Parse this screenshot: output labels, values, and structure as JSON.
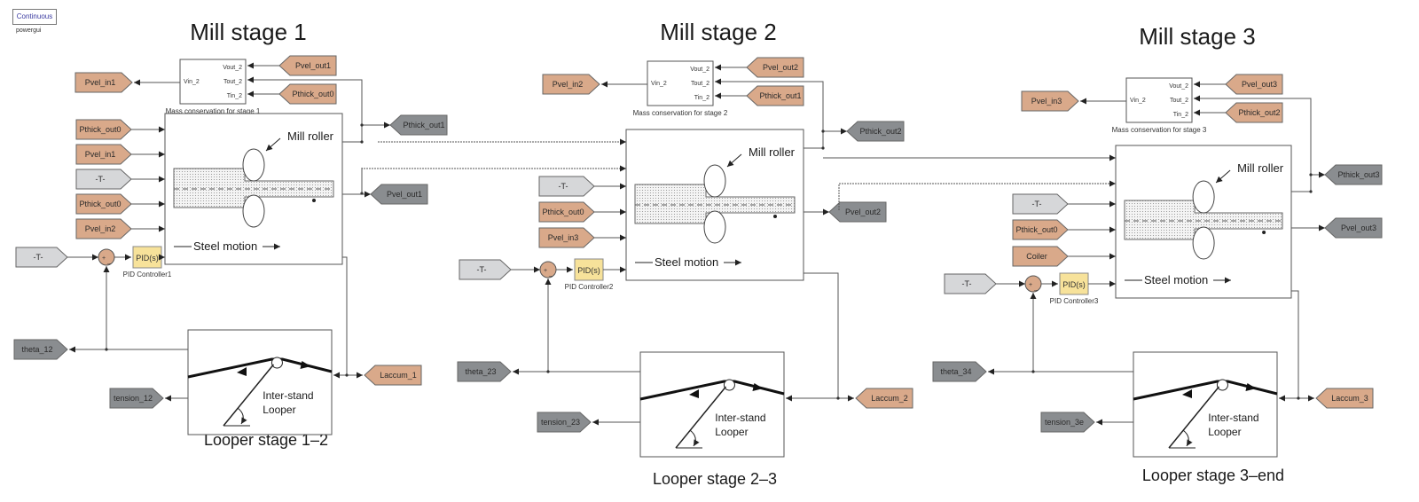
{
  "powergui": {
    "block_label": "Continuous",
    "name": "powergui"
  },
  "colors": {
    "goto_tag": "#d9a98a",
    "from_tag": "#8a8d90",
    "const_tag": "#d6d7d9",
    "pid": "#f7e29a",
    "sum": "#d9a98a",
    "wire": "#555555"
  },
  "stages": [
    {
      "title": "Mill stage 1",
      "mass_block": {
        "caption": "Mass conservation for stage 1",
        "port_in": "Vin_2",
        "ports_out": [
          "Vout_2",
          "Tout_2",
          "Tin_2"
        ]
      },
      "mass_left_tag": "Pvel_in1",
      "mass_right_tags": [
        "Pvel_out1",
        "Pthick_out0"
      ],
      "mill_inputs": [
        "Pthick_out0",
        "Pvel_in1",
        "-T-",
        "Pthick_out0",
        "Pvel_in2"
      ],
      "mill_label": "Mill roller",
      "steel_label": "Steel motion",
      "pid": {
        "text": "PID(s)",
        "caption": "PID Controller1"
      },
      "const_tag": "-T-",
      "out_tags": [
        "Pthick_out1",
        "Pvel_out1"
      ]
    },
    {
      "title": "Mill stage 2",
      "mass_block": {
        "caption": "Mass conservation for stage 2",
        "port_in": "Vin_2",
        "ports_out": [
          "Vout_2",
          "Tout_2",
          "Tin_2"
        ]
      },
      "mass_left_tag": "Pvel_in2",
      "mass_right_tags": [
        "Pvel_out2",
        "Pthick_out1"
      ],
      "mill_inputs": [
        "-T-",
        "Pthick_out0",
        "Pvel_in3"
      ],
      "mill_label": "Mill roller",
      "steel_label": "Steel motion",
      "pid": {
        "text": "PID(s)",
        "caption": "PID Controller2"
      },
      "const_tag": "-T-",
      "out_tags": [
        "Pthick_out2",
        "Pvel_out2"
      ]
    },
    {
      "title": "Mill stage 3",
      "mass_block": {
        "caption": "Mass conservation for stage 3",
        "port_in": "Vin_2",
        "ports_out": [
          "Vout_2",
          "Tout_2",
          "Tin_2"
        ]
      },
      "mass_left_tag": "Pvel_in3",
      "mass_right_tags": [
        "Pvel_out3",
        "Pthick_out2"
      ],
      "mill_inputs": [
        "-T-",
        "Pthick_out0",
        "Coiler"
      ],
      "mill_label": "Mill roller",
      "steel_label": "Steel motion",
      "pid": {
        "text": "PID(s)",
        "caption": "PID Controller3"
      },
      "const_tag": "-T-",
      "out_tags": [
        "Pthick_out3",
        "Pvel_out3"
      ]
    }
  ],
  "loopers": [
    {
      "title": "Looper stage 1–2",
      "label_line1": "Inter-stand",
      "label_line2": "Looper",
      "theta_tag": "theta_12",
      "tension_tag": "tension_12",
      "laccum_tag": "Laccum_1"
    },
    {
      "title": "Looper stage 2–3",
      "label_line1": "Inter-stand",
      "label_line2": "Looper",
      "theta_tag": "theta_23",
      "tension_tag": "tension_23",
      "laccum_tag": "Laccum_2"
    },
    {
      "title": "Looper stage 3–end",
      "label_line1": "Inter-stand",
      "label_line2": "Looper",
      "theta_tag": "theta_34",
      "tension_tag": "tension_3e",
      "laccum_tag": "Laccum_3"
    }
  ]
}
